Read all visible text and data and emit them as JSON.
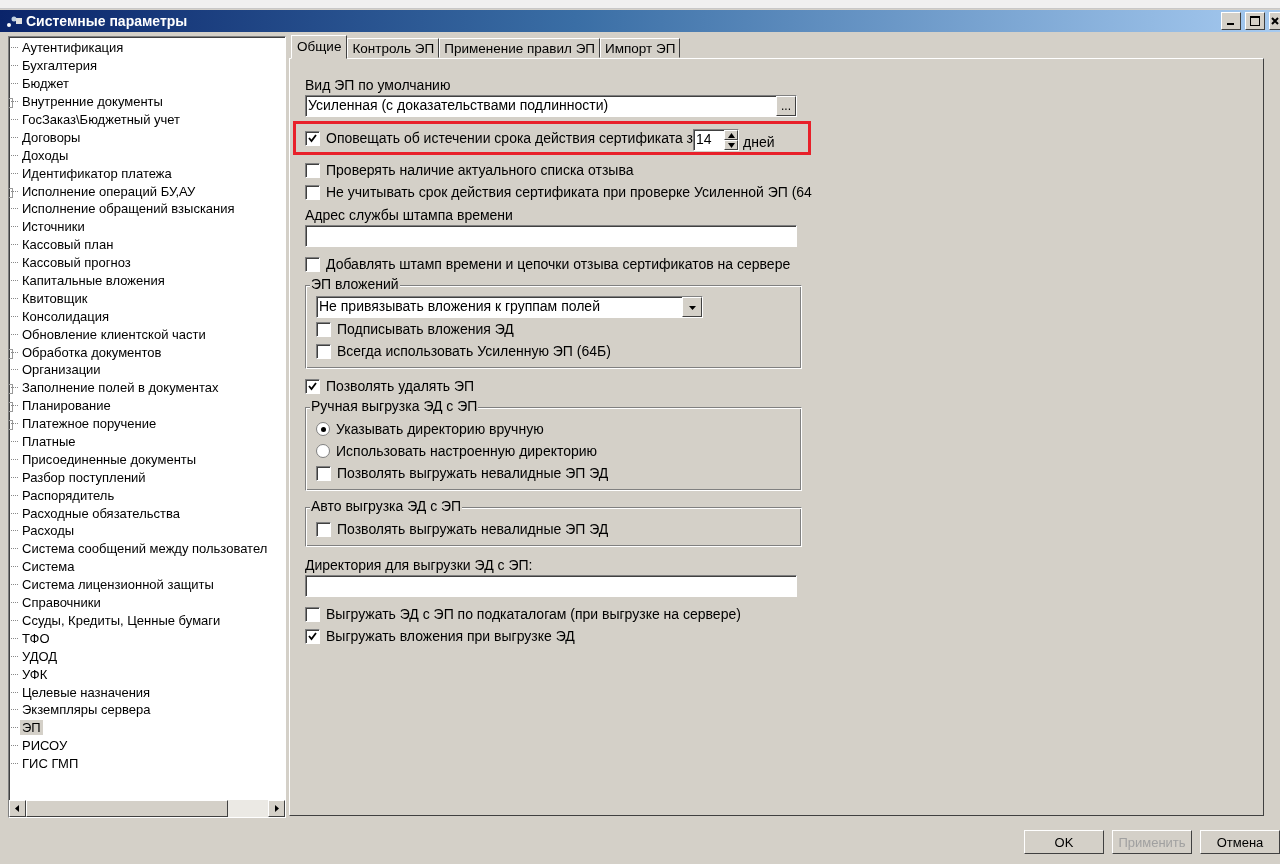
{
  "window": {
    "title": "Системные параметры"
  },
  "tree": {
    "items": [
      {
        "label": "Аутентификация",
        "expandable": false,
        "selected": false
      },
      {
        "label": "Бухгалтерия",
        "expandable": false,
        "selected": false
      },
      {
        "label": "Бюджет",
        "expandable": false,
        "selected": false
      },
      {
        "label": "Внутренние документы",
        "expandable": true,
        "selected": false
      },
      {
        "label": "ГосЗаказ\\Бюджетный учет",
        "expandable": false,
        "selected": false
      },
      {
        "label": "Договоры",
        "expandable": false,
        "selected": false
      },
      {
        "label": "Доходы",
        "expandable": false,
        "selected": false
      },
      {
        "label": "Идентификатор платежа",
        "expandable": false,
        "selected": false
      },
      {
        "label": "Исполнение операций БУ,АУ",
        "expandable": true,
        "selected": false
      },
      {
        "label": "Исполнение обращений взыскания",
        "expandable": false,
        "selected": false
      },
      {
        "label": "Источники",
        "expandable": false,
        "selected": false
      },
      {
        "label": "Кассовый план",
        "expandable": false,
        "selected": false
      },
      {
        "label": "Кассовый прогноз",
        "expandable": false,
        "selected": false
      },
      {
        "label": "Капитальные вложения",
        "expandable": false,
        "selected": false
      },
      {
        "label": "Квитовщик",
        "expandable": false,
        "selected": false
      },
      {
        "label": "Консолидация",
        "expandable": false,
        "selected": false
      },
      {
        "label": "Обновление клиентской части",
        "expandable": false,
        "selected": false
      },
      {
        "label": "Обработка документов",
        "expandable": true,
        "selected": false
      },
      {
        "label": "Организации",
        "expandable": false,
        "selected": false
      },
      {
        "label": "Заполнение полей в документах",
        "expandable": true,
        "selected": false
      },
      {
        "label": "Планирование",
        "expandable": true,
        "selected": false
      },
      {
        "label": "Платежное поручение",
        "expandable": true,
        "selected": false
      },
      {
        "label": "Платные",
        "expandable": false,
        "selected": false
      },
      {
        "label": "Присоединенные документы",
        "expandable": false,
        "selected": false
      },
      {
        "label": "Разбор поступлений",
        "expandable": false,
        "selected": false
      },
      {
        "label": "Распорядитель",
        "expandable": false,
        "selected": false
      },
      {
        "label": "Расходные обязательства",
        "expandable": false,
        "selected": false
      },
      {
        "label": "Расходы",
        "expandable": false,
        "selected": false
      },
      {
        "label": "Система сообщений между пользовател",
        "expandable": false,
        "selected": false
      },
      {
        "label": "Система",
        "expandable": false,
        "selected": false
      },
      {
        "label": "Система лицензионной защиты",
        "expandable": false,
        "selected": false
      },
      {
        "label": "Справочники",
        "expandable": false,
        "selected": false
      },
      {
        "label": "Ссуды, Кредиты, Ценные бумаги",
        "expandable": false,
        "selected": false
      },
      {
        "label": "ТФО",
        "expandable": false,
        "selected": false
      },
      {
        "label": "УДОД",
        "expandable": false,
        "selected": false
      },
      {
        "label": "УФК",
        "expandable": false,
        "selected": false
      },
      {
        "label": "Целевые назначения",
        "expandable": false,
        "selected": false
      },
      {
        "label": "Экземпляры сервера",
        "expandable": false,
        "selected": false
      },
      {
        "label": "ЭП",
        "expandable": false,
        "selected": true
      },
      {
        "label": "РИСОУ",
        "expandable": false,
        "selected": false
      },
      {
        "label": "ГИС ГМП",
        "expandable": false,
        "selected": false
      }
    ]
  },
  "tabs": [
    {
      "label": "Общие",
      "selected": true
    },
    {
      "label": "Контроль ЭП",
      "selected": false
    },
    {
      "label": "Применение правил ЭП",
      "selected": false
    },
    {
      "label": "Импорт ЭП",
      "selected": false
    }
  ],
  "rows": [
    {
      "kind": "caption",
      "label": "Вид ЭП по умолчанию"
    },
    {
      "kind": "picker",
      "value": "Усиленная (с доказательствами подлинности)",
      "button": "..."
    },
    {
      "kind": "spin_checkbox",
      "label": "Оповещать об истечении срока действия сертификата з",
      "checked": true,
      "value": "14",
      "unit": "дней",
      "highlighted": true
    },
    {
      "kind": "checkbox",
      "label": "Проверять наличие актуального списка отзыва",
      "checked": false
    },
    {
      "kind": "checkbox",
      "label": "Не учитывать срок действия сертификата при проверке Усиленной ЭП (64",
      "checked": false
    },
    {
      "kind": "caption",
      "label": "Адрес службы штампа времени"
    },
    {
      "kind": "input"
    },
    {
      "kind": "checkbox",
      "label": "Добавлять штамп времени и цепочки отзыва сертификатов на сервере",
      "checked": false
    },
    {
      "kind": "group",
      "title": "ЭП вложений",
      "children": [
        {
          "kind": "select",
          "value": "Не привязывать вложения к группам полей"
        },
        {
          "kind": "checkbox",
          "label": "Подписывать вложения ЭД",
          "checked": false
        },
        {
          "kind": "checkbox",
          "label": "Всегда использовать Усиленную ЭП (64Б)",
          "checked": false
        }
      ]
    },
    {
      "kind": "checkbox",
      "label": "Позволять удалять ЭП",
      "checked": true
    },
    {
      "kind": "group",
      "title": "Ручная выгрузка ЭД с ЭП",
      "children": [
        {
          "kind": "radio",
          "label": "Указывать директорию вручную",
          "selected": true
        },
        {
          "kind": "radio",
          "label": "Использовать настроенную директорию",
          "selected": false
        },
        {
          "kind": "checkbox",
          "label": "Позволять выгружать невалидные ЭП ЭД",
          "checked": false
        }
      ]
    },
    {
      "kind": "group",
      "title": "Авто выгрузка ЭД с ЭП",
      "children": [
        {
          "kind": "checkbox",
          "label": "Позволять выгружать невалидные ЭП ЭД",
          "checked": false
        }
      ]
    },
    {
      "kind": "caption",
      "label": "Директория для выгрузки ЭД с ЭП:"
    },
    {
      "kind": "input"
    },
    {
      "kind": "checkbox",
      "label": "Выгружать ЭД с ЭП по подкаталогам (при выгрузке на сервере)",
      "checked": false
    },
    {
      "kind": "checkbox",
      "label": "Выгружать вложения при выгрузке ЭД",
      "checked": true
    }
  ],
  "buttons": [
    {
      "label": "OK",
      "disabled": false
    },
    {
      "label": "Применить",
      "disabled": true
    },
    {
      "label": "Отмена",
      "disabled": false
    }
  ]
}
